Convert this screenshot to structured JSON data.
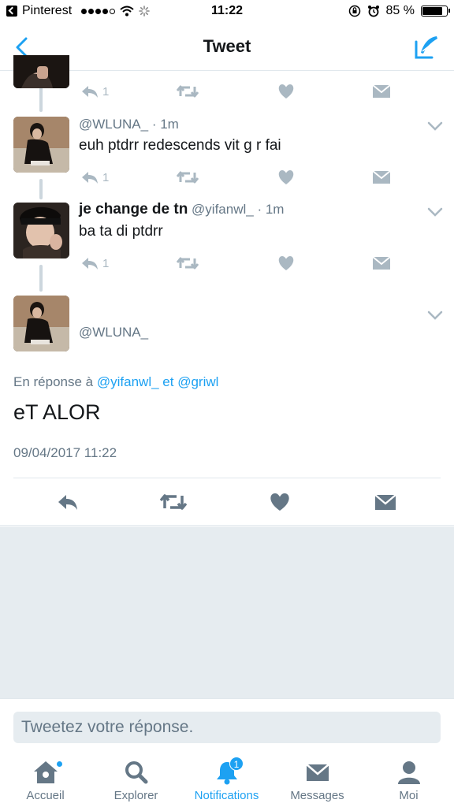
{
  "status_bar": {
    "app": "Pinterest",
    "time": "11:22",
    "battery": "85 %",
    "battery_level": 0.85
  },
  "nav": {
    "title": "Tweet"
  },
  "thread": [
    {
      "reply_count": "1"
    },
    {
      "handle": "@WLUNA_",
      "time": "· 1m",
      "text": "euh ptdrr redescends vit g r fai",
      "reply_count": "1"
    },
    {
      "name": "je change de tn",
      "handle": "@yifanwl_",
      "time": "· 1m",
      "text": "ba ta di ptdrr",
      "reply_count": "1"
    }
  ],
  "main_tweet": {
    "handle": "@WLUNA_",
    "reply_prefix": "En réponse à",
    "reply_user_1": "@yifanwl_",
    "reply_and": "et",
    "reply_user_2": "@griwl",
    "text": "eT ALOR",
    "timestamp": "09/04/2017 11:22"
  },
  "reply_bar": {
    "placeholder": "Tweetez votre réponse."
  },
  "tabs": [
    {
      "label": "Accueil",
      "icon": "home-icon"
    },
    {
      "label": "Explorer",
      "icon": "search-icon"
    },
    {
      "label": "Notifications",
      "icon": "bell-icon",
      "badge": "1"
    },
    {
      "label": "Messages",
      "icon": "envelope-icon"
    },
    {
      "label": "Moi",
      "icon": "person-icon"
    }
  ],
  "colors": {
    "accent": "#1da1f2",
    "muted": "#657786",
    "icon_gray": "#aab8c2",
    "background_gray": "#e6ecf0"
  }
}
